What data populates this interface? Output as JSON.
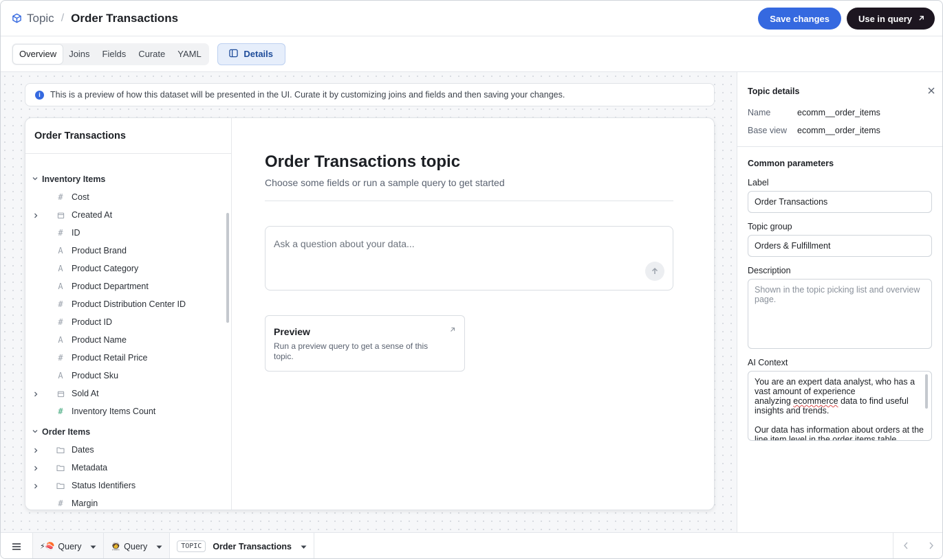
{
  "breadcrumb": {
    "topic": "Topic",
    "separator": "/",
    "title": "Order Transactions"
  },
  "header": {
    "save_label": "Save changes",
    "use_label": "Use in query"
  },
  "tabs": [
    {
      "label": "Overview",
      "active": true
    },
    {
      "label": "Joins"
    },
    {
      "label": "Fields"
    },
    {
      "label": "Curate"
    },
    {
      "label": "YAML"
    }
  ],
  "details_toggle": "Details",
  "info_banner": "This is a preview of how this dataset will be presented in the UI. Curate it by customizing joins and fields and then saving your changes.",
  "tree": {
    "title": "Order Transactions",
    "groups": [
      {
        "label": "Inventory Items",
        "items": [
          {
            "label": "Cost",
            "icon": "number-icon"
          },
          {
            "label": "Created At",
            "icon": "calendar-icon",
            "expandable": true
          },
          {
            "label": "ID",
            "icon": "number-icon"
          },
          {
            "label": "Product Brand",
            "icon": "text-icon"
          },
          {
            "label": "Product Category",
            "icon": "text-icon"
          },
          {
            "label": "Product Department",
            "icon": "text-icon"
          },
          {
            "label": "Product Distribution Center ID",
            "icon": "number-icon"
          },
          {
            "label": "Product ID",
            "icon": "number-icon"
          },
          {
            "label": "Product Name",
            "icon": "text-icon"
          },
          {
            "label": "Product Retail Price",
            "icon": "number-icon"
          },
          {
            "label": "Product Sku",
            "icon": "text-icon"
          },
          {
            "label": "Sold At",
            "icon": "calendar-icon",
            "expandable": true
          },
          {
            "label": "Inventory Items Count",
            "icon": "measure-icon"
          }
        ]
      },
      {
        "label": "Order Items",
        "items": [
          {
            "label": "Dates",
            "icon": "folder-icon",
            "expandable": true
          },
          {
            "label": "Metadata",
            "icon": "folder-icon",
            "expandable": true
          },
          {
            "label": "Status Identifiers",
            "icon": "folder-icon",
            "expandable": true
          },
          {
            "label": "Margin",
            "icon": "number-icon"
          }
        ]
      }
    ]
  },
  "main": {
    "title": "Order Transactions topic",
    "subtitle": "Choose some fields or run a sample query to get started",
    "ask_placeholder": "Ask a question about your data...",
    "preview_title": "Preview",
    "preview_desc": "Run a preview query to get a sense of this topic."
  },
  "details": {
    "heading": "Topic details",
    "name_label": "Name",
    "name_value": "ecomm__order_items",
    "base_view_label": "Base view",
    "base_view_value": "ecomm__order_items",
    "section": "Common parameters",
    "label_label": "Label",
    "label_value": "Order Transactions",
    "group_label": "Topic group",
    "group_value": "Orders & Fulfillment",
    "description_label": "Description",
    "description_placeholder": "Shown in the topic picking list and overview page.",
    "ai_label": "AI Context",
    "ai_line1": "You are an expert data analyst, who has a vast amount of experience",
    "ai_line2a": "analyzing ",
    "ai_line2b": "ecommerce",
    "ai_line2c": " data to find useful insights and trends.",
    "ai_line3": "Our data has information about orders at the line item level in the order items table."
  },
  "bottom_tabs": [
    {
      "emoji": "⚡🍣",
      "label": "Query"
    },
    {
      "emoji": "🧑‍🚀",
      "label": "Query"
    },
    {
      "badge": "TOPIC",
      "label": "Order Transactions",
      "active": true
    }
  ]
}
